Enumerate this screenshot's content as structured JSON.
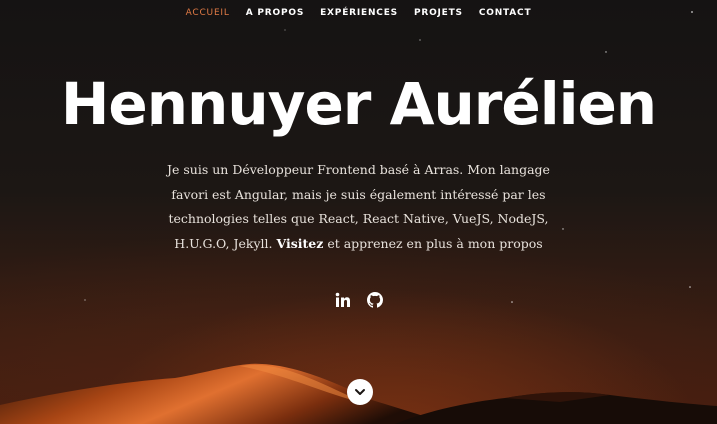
{
  "nav": {
    "items": [
      {
        "label": "ACCUEIL",
        "active": true
      },
      {
        "label": "A PROPOS",
        "active": false
      },
      {
        "label": "EXPÉRIENCES",
        "active": false
      },
      {
        "label": "PROJETS",
        "active": false
      },
      {
        "label": "CONTACT",
        "active": false
      }
    ]
  },
  "hero": {
    "title": "Hennuyer Aurélien",
    "intro_before": "Je suis un Développeur Frontend basé à Arras. Mon langage favori est Angular, mais je suis également intéressé par les technologies telles que React, React Native, VueJS, NodeJS, H.U.G.O, Jekyll. ",
    "intro_link": "Visitez",
    "intro_after": " et apprenez en plus à mon propos"
  },
  "socials": [
    {
      "icon": "linkedin-icon"
    },
    {
      "icon": "github-icon"
    }
  ],
  "scroll_icon": "chevron-down-icon",
  "colors": {
    "accent": "#e07a45",
    "text": "#ffffff",
    "background": "#1b1614"
  }
}
